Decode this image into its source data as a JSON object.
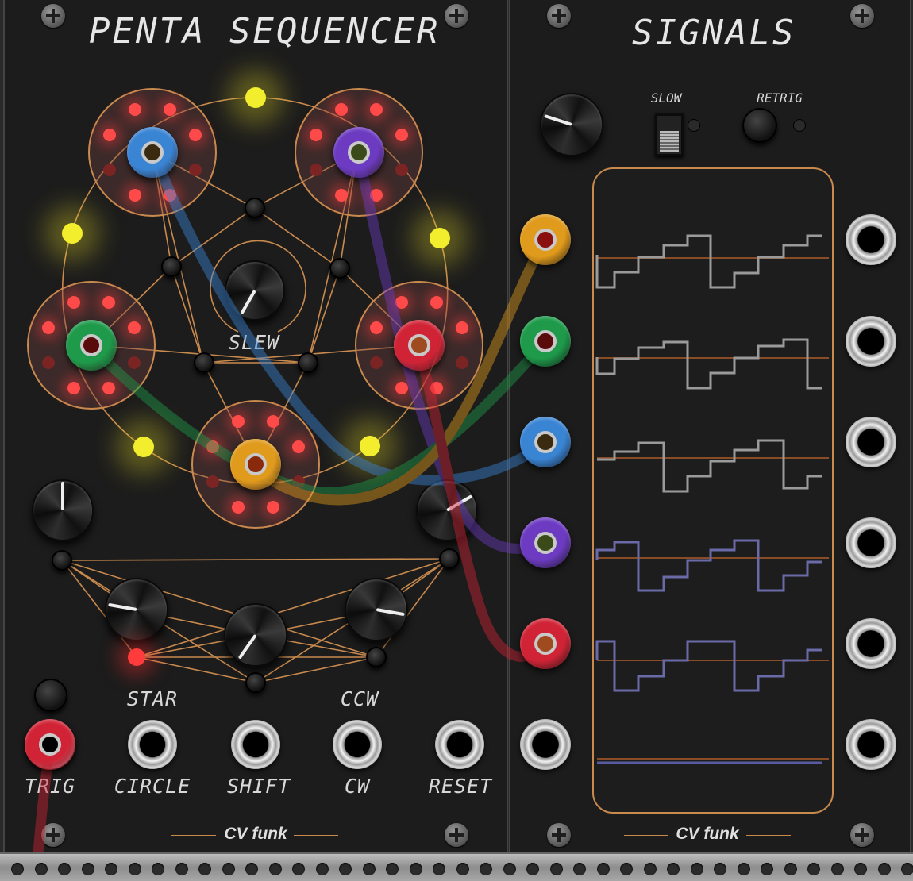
{
  "penta": {
    "title": "PENTA SEQUENCER",
    "slew_label": "SLEW",
    "star_label": "STAR",
    "ccw_label": "CCW",
    "brand": "CV funk",
    "jacks": [
      {
        "id": "trig",
        "label": "TRIG"
      },
      {
        "id": "circle",
        "label": "CIRCLE"
      },
      {
        "id": "shift",
        "label": "SHIFT"
      },
      {
        "id": "cw",
        "label": "CW"
      },
      {
        "id": "reset",
        "label": "RESET"
      }
    ]
  },
  "signals": {
    "title": "SIGNALS",
    "slow_label": "SLOW",
    "retrig_label": "RETRIG",
    "brand": "CV funk"
  },
  "colors": {
    "panel": "#1c1c1c",
    "accent_line": "#c98a4e",
    "led_red": "#ff3b3b",
    "led_yellow": "#f2ee2e",
    "cable_blue": "#3a84d4",
    "cable_purple": "#6c3bc1",
    "cable_green": "#1e9a4a",
    "cable_orange": "#e09a1c",
    "cable_red": "#d02436",
    "trace_gray": "#9a9a9a",
    "trace_violet": "#6a6aa8"
  },
  "cables": [
    {
      "color": "blue",
      "from": "penta-top-left-output",
      "to": "signals-input-3"
    },
    {
      "color": "purple",
      "from": "penta-top-right-output",
      "to": "signals-input-4"
    },
    {
      "color": "green",
      "from": "penta-left-output",
      "to": "signals-input-2"
    },
    {
      "color": "orange",
      "from": "penta-bottom-output",
      "to": "signals-input-1"
    },
    {
      "color": "red",
      "from": "penta-right-output",
      "to": "signals-input-5"
    },
    {
      "color": "red",
      "from": "trig-input",
      "to": "off-screen"
    }
  ],
  "icons": {
    "screw": "cross-screw-icon",
    "jack": "jack-socket-icon",
    "cable_plug": "cable-plug-icon"
  }
}
